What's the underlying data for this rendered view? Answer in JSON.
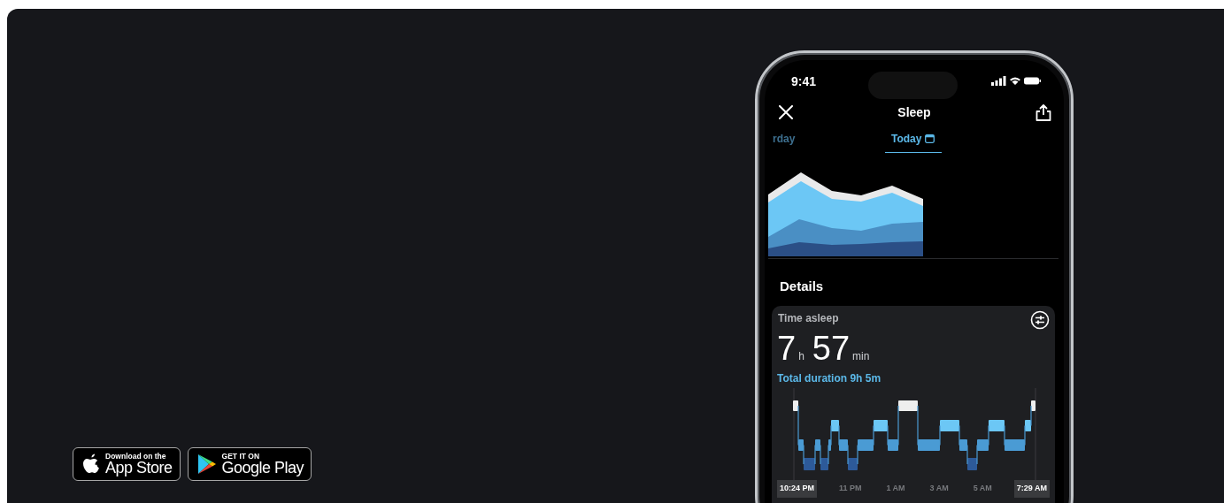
{
  "store_badges": [
    {
      "kind": "apple",
      "top_text": "Download on the",
      "name": "App Store"
    },
    {
      "kind": "google",
      "top_text": "GET IT ON",
      "name": "Google Play"
    }
  ],
  "phone": {
    "status_bar": {
      "time": "9:41"
    },
    "header": {
      "title": "Sleep"
    },
    "date_tabs": [
      {
        "label": "rday",
        "selected": false
      },
      {
        "label": "Today",
        "selected": true
      }
    ],
    "section_title": "Details",
    "card": {
      "title": "Time asleep",
      "hours": "7",
      "hours_unit": "h",
      "minutes": "57",
      "minutes_unit": "min",
      "total": "Total duration 9h 5m",
      "axis_labels": [
        {
          "label": "10:24 PM",
          "highlighted": true
        },
        {
          "label": "11 PM",
          "highlighted": false
        },
        {
          "label": "1 AM",
          "highlighted": false
        },
        {
          "label": "3 AM",
          "highlighted": false
        },
        {
          "label": "5 AM",
          "highlighted": false
        },
        {
          "label": "7:29 AM",
          "highlighted": true
        }
      ]
    }
  }
}
